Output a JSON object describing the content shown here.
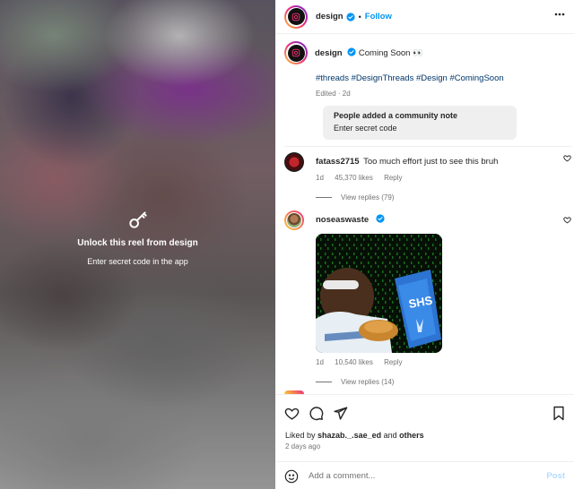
{
  "media": {
    "unlock_title": "Unlock this reel from design",
    "unlock_subtitle": "Enter secret code in the app"
  },
  "header": {
    "username": "design",
    "separator": "•",
    "follow_label": "Follow"
  },
  "caption": {
    "username": "design",
    "text": "Coming Soon 👀",
    "hashtags": "#threads #DesignThreads #Design #ComingSoon",
    "edited": "Edited · 2d"
  },
  "community_note": {
    "title": "People added a community note",
    "text": "Enter secret code"
  },
  "comments": [
    {
      "username": "fatass2715",
      "text": "Too much effort just to see this bruh",
      "time": "1d",
      "likes": "45,370 likes",
      "reply_label": "Reply",
      "view_replies": "View replies (79)"
    },
    {
      "username": "noseaswaste",
      "text": "",
      "time": "1d",
      "likes": "10,540 likes",
      "reply_label": "Reply",
      "view_replies": "View replies (14)"
    }
  ],
  "gif_label": "SHS",
  "footer": {
    "liked_prefix": "Liked by",
    "liked_user": "shazab._.sae_ed",
    "liked_and": "and",
    "liked_others": "others",
    "date": "2 days ago",
    "comment_placeholder": "Add a comment...",
    "post_label": "Post"
  },
  "colors": {
    "accent": "#0095f6",
    "verified": "#0095f6",
    "hashtag": "#00376b",
    "muted": "#737373"
  }
}
